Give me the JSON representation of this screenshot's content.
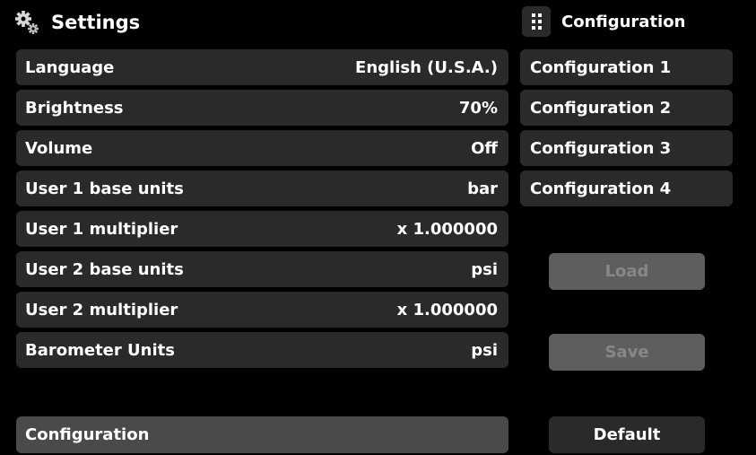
{
  "header": {
    "title": "Settings",
    "icon": "gears-icon"
  },
  "settings": [
    {
      "label": "Language",
      "value": "English (U.S.A.)"
    },
    {
      "label": "Brightness",
      "value": "70%"
    },
    {
      "label": "Volume",
      "value": "Off"
    },
    {
      "label": "User 1 base units",
      "value": "bar"
    },
    {
      "label": "User 1 multiplier",
      "value": "x 1.000000"
    },
    {
      "label": "User 2 base units",
      "value": "psi"
    },
    {
      "label": "User 2 multiplier",
      "value": "x 1.000000"
    },
    {
      "label": "Barometer Units",
      "value": "psi"
    }
  ],
  "config_panel": {
    "title": "Configuration",
    "icon": "grid-menu-icon",
    "items": [
      "Configuration 1",
      "Configuration 2",
      "Configuration 3",
      "Configuration 4"
    ]
  },
  "buttons": {
    "load": "Load",
    "save": "Save",
    "default": "Default"
  },
  "footer": {
    "configuration": "Configuration"
  },
  "colors": {
    "background": "#000000",
    "row": "#2a2a2a",
    "disabled_button": "#5e5e5e",
    "disabled_text": "#878787",
    "footer_bar": "#4a4a4a",
    "text": "#ffffff"
  }
}
